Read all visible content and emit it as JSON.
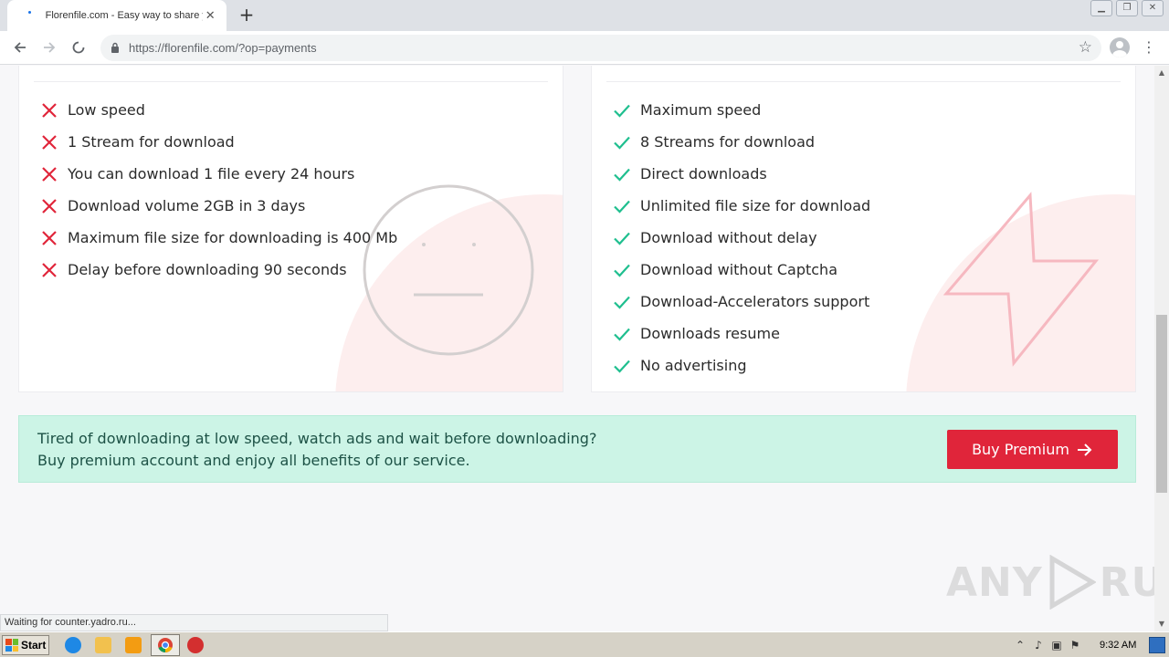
{
  "browser": {
    "tab_title": "Florenfile.com - Easy way to share y",
    "tab_close": "✕",
    "new_tab": "+",
    "url": "https://florenfile.com/?op=payments",
    "status_text": "Waiting for counter.yadro.ru..."
  },
  "free_plan": {
    "features": [
      "Low speed",
      "1 Stream for download",
      "You can download 1 file every 24 hours",
      "Download volume 2GB in 3 days",
      "Maximum file size for downloading is 400 Mb",
      "Delay before downloading 90 seconds"
    ],
    "feature_icon": "x-icon",
    "icon_color": "#e0253a"
  },
  "premium_plan": {
    "features": [
      "Maximum speed",
      "8 Streams for download",
      "Direct downloads",
      "Unlimited file size for download",
      "Download without delay",
      "Download without Captcha",
      "Download-Accelerators support",
      "Downloads resume",
      "No advertising"
    ],
    "feature_icon": "check-icon",
    "icon_color": "#1fbf8f"
  },
  "banner": {
    "line1": "Tired of downloading at low speed, watch ads and wait before downloading?",
    "line2": "Buy premium account and enjoy all benefits of our service.",
    "button_label": "Buy Premium",
    "background": "#ccf4e6",
    "button_color": "#e0253a"
  },
  "watermark": {
    "left": "ANY",
    "right": "RUN"
  },
  "taskbar": {
    "start_label": "Start",
    "clock": "9:32 AM"
  }
}
